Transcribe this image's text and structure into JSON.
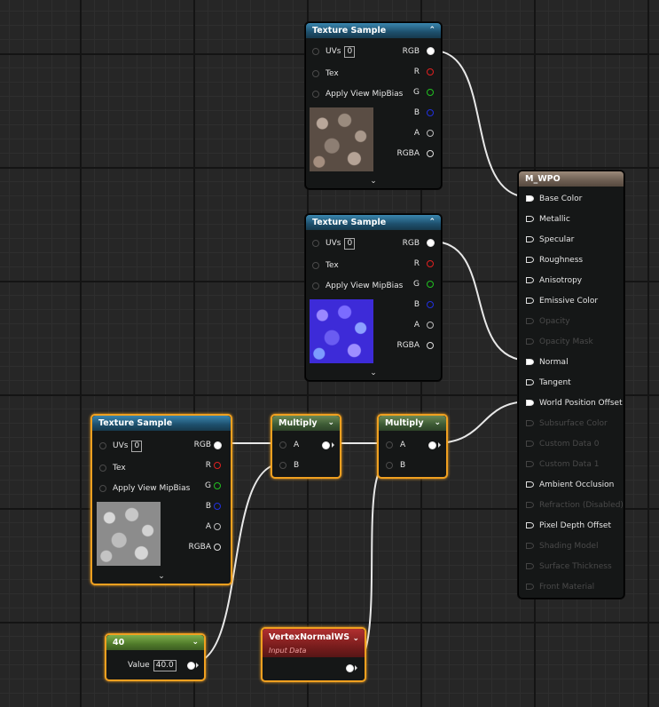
{
  "texture_sample_1": {
    "title": "Texture Sample",
    "inputs": {
      "uvs": "UVs",
      "uvs_value": "0",
      "tex": "Tex",
      "mip": "Apply View MipBias"
    },
    "outputs": {
      "rgb": "RGB",
      "r": "R",
      "g": "G",
      "b": "B",
      "a": "A",
      "rgba": "RGBA"
    },
    "thumbnail": "cobblestone-color-texture"
  },
  "texture_sample_2": {
    "title": "Texture Sample",
    "inputs": {
      "uvs": "UVs",
      "uvs_value": "0",
      "tex": "Tex",
      "mip": "Apply View MipBias"
    },
    "outputs": {
      "rgb": "RGB",
      "r": "R",
      "g": "G",
      "b": "B",
      "a": "A",
      "rgba": "RGBA"
    },
    "thumbnail": "cobblestone-normal-texture"
  },
  "texture_sample_3": {
    "title": "Texture Sample",
    "inputs": {
      "uvs": "UVs",
      "uvs_value": "0",
      "tex": "Tex",
      "mip": "Apply View MipBias"
    },
    "outputs": {
      "rgb": "RGB",
      "r": "R",
      "g": "G",
      "b": "B",
      "a": "A",
      "rgba": "RGBA"
    },
    "thumbnail": "cobblestone-height-texture"
  },
  "multiply_1": {
    "title": "Multiply",
    "input_a": "A",
    "input_b": "B"
  },
  "multiply_2": {
    "title": "Multiply",
    "input_a": "A",
    "input_b": "B"
  },
  "constant": {
    "title": "40",
    "value_label": "Value",
    "value": "40.0"
  },
  "vertex_normal": {
    "title": "VertexNormalWS",
    "subtitle": "Input Data"
  },
  "material": {
    "title": "M_WPO",
    "pins": [
      {
        "label": "Base Color",
        "enabled": true,
        "connected": true
      },
      {
        "label": "Metallic",
        "enabled": true,
        "connected": false
      },
      {
        "label": "Specular",
        "enabled": true,
        "connected": false
      },
      {
        "label": "Roughness",
        "enabled": true,
        "connected": false
      },
      {
        "label": "Anisotropy",
        "enabled": true,
        "connected": false
      },
      {
        "label": "Emissive Color",
        "enabled": true,
        "connected": false
      },
      {
        "label": "Opacity",
        "enabled": false,
        "connected": false
      },
      {
        "label": "Opacity Mask",
        "enabled": false,
        "connected": false
      },
      {
        "label": "Normal",
        "enabled": true,
        "connected": true
      },
      {
        "label": "Tangent",
        "enabled": true,
        "connected": false
      },
      {
        "label": "World Position Offset",
        "enabled": true,
        "connected": true
      },
      {
        "label": "Subsurface Color",
        "enabled": false,
        "connected": false
      },
      {
        "label": "Custom Data 0",
        "enabled": false,
        "connected": false
      },
      {
        "label": "Custom Data 1",
        "enabled": false,
        "connected": false
      },
      {
        "label": "Ambient Occlusion",
        "enabled": true,
        "connected": false
      },
      {
        "label": "Refraction (Disabled)",
        "enabled": false,
        "connected": false
      },
      {
        "label": "Pixel Depth Offset",
        "enabled": true,
        "connected": false
      },
      {
        "label": "Shading Model",
        "enabled": false,
        "connected": false
      },
      {
        "label": "Surface Thickness",
        "enabled": false,
        "connected": false
      },
      {
        "label": "Front Material",
        "enabled": false,
        "connected": false
      }
    ]
  },
  "colors": {
    "selection": "#f0a020",
    "texture_header": "#1d4f6c",
    "math_header": "#3c5a34",
    "constant_header": "#4f7a2a",
    "input_data_header": "#7a1d1d",
    "material_header": "#6d5e52"
  }
}
